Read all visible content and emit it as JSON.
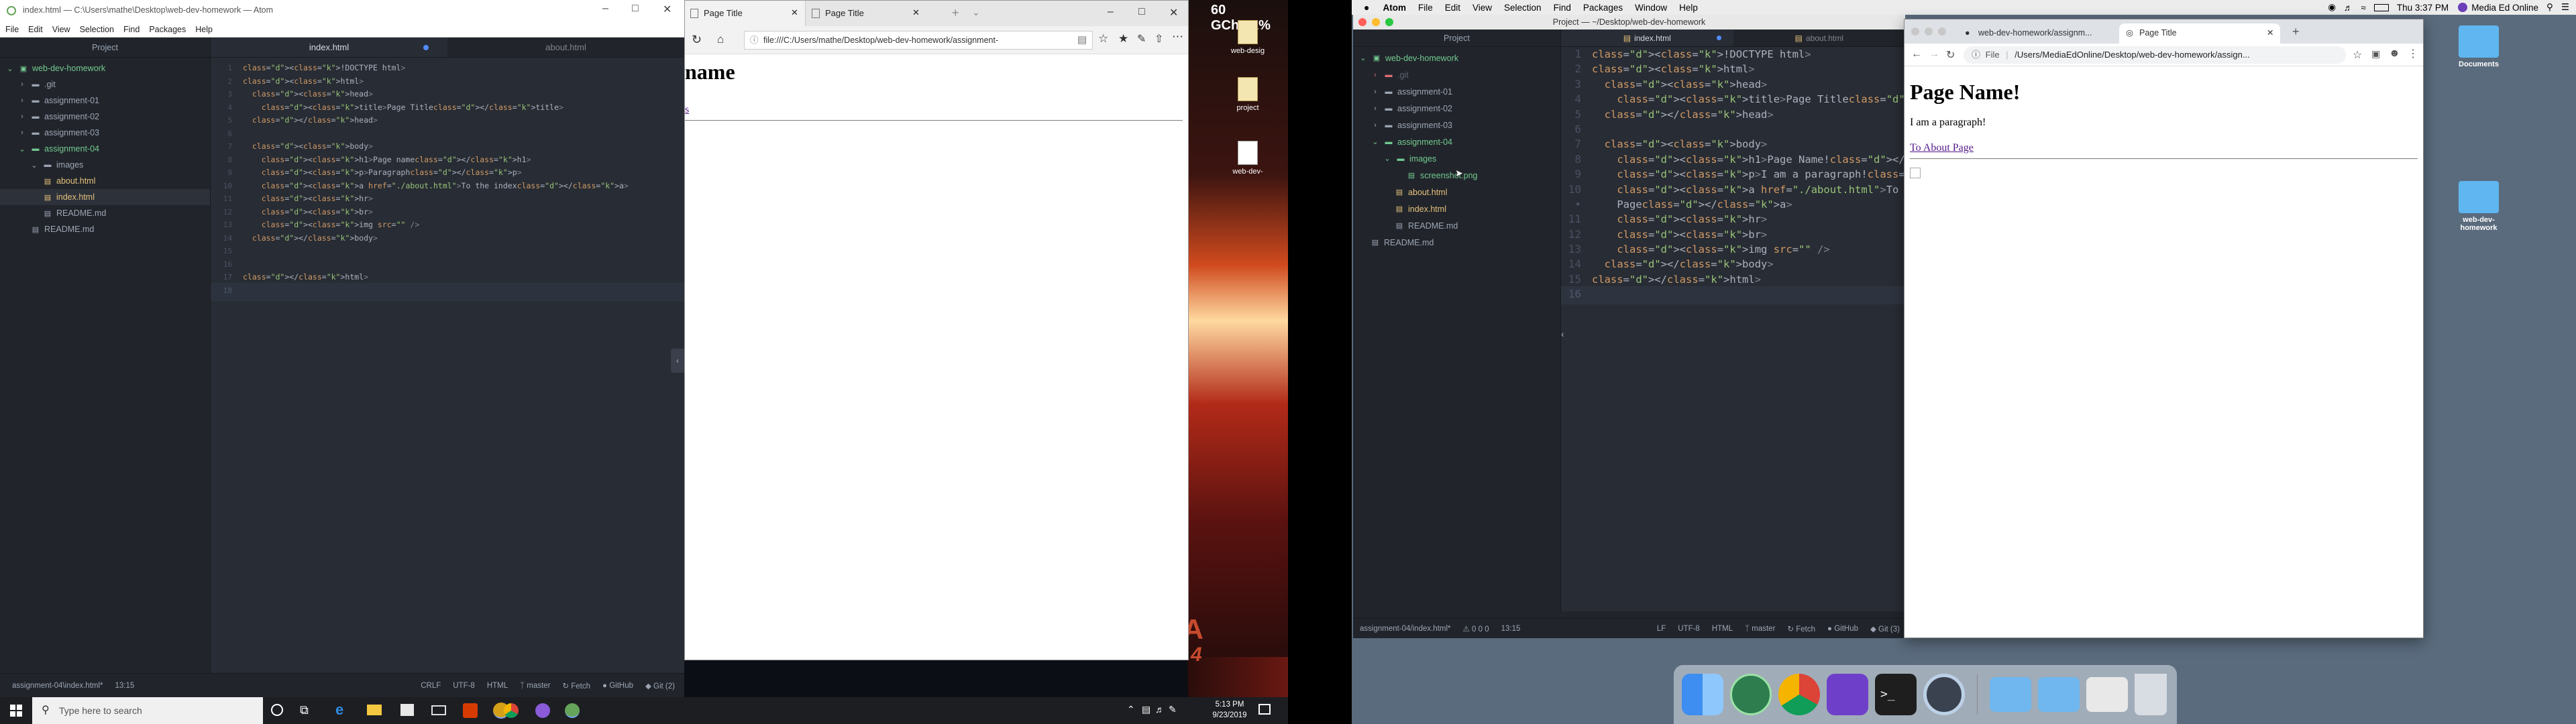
{
  "left": {
    "atom": {
      "window_title": "index.html — C:\\Users\\mathe\\Desktop\\web-dev-homework — Atom",
      "menu": [
        "File",
        "Edit",
        "View",
        "Selection",
        "Find",
        "Packages",
        "Help"
      ],
      "project_header": "Project",
      "tree": [
        {
          "label": "web-dev-homework",
          "type": "root",
          "depth": 0
        },
        {
          "label": ".git",
          "type": "folder",
          "depth": 1
        },
        {
          "label": "assignment-01",
          "type": "folder",
          "depth": 1
        },
        {
          "label": "assignment-02",
          "type": "folder",
          "depth": 1
        },
        {
          "label": "assignment-03",
          "type": "folder",
          "depth": 1
        },
        {
          "label": "assignment-04",
          "type": "folder-open",
          "depth": 1
        },
        {
          "label": "images",
          "type": "folder-open",
          "depth": 2
        },
        {
          "label": "about.html",
          "type": "file",
          "depth": 2
        },
        {
          "label": "index.html",
          "type": "file-active",
          "depth": 2
        },
        {
          "label": "README.md",
          "type": "file",
          "depth": 2
        },
        {
          "label": "README.md",
          "type": "file",
          "depth": 1
        }
      ],
      "tabs": [
        {
          "label": "index.html",
          "active": true,
          "modified": true
        },
        {
          "label": "about.html",
          "active": false,
          "modified": false
        }
      ],
      "line_numbers": [
        "1",
        "2",
        "3",
        "4",
        "5",
        "6",
        "7",
        "8",
        "9",
        "10",
        "11",
        "12",
        "13",
        "14",
        "15",
        "16",
        "17",
        "18"
      ],
      "code": [
        "<!DOCTYPE html>",
        "<html>",
        "  <head>",
        "    <title>Page Title</title>",
        "  </head>",
        "",
        "  <body>",
        "    <h1>Page name</h1>",
        "    <p>Paragraph</p>",
        "    <a href=\"./about.html\">To the index</a>",
        "    <hr>",
        "    <br>",
        "    <img src=\"\" />",
        "  </body>",
        "",
        "",
        "</html>",
        ""
      ],
      "status": {
        "path": "assignment-04\\index.html*",
        "cursor": "13:15",
        "items": [
          "CRLF",
          "UTF-8",
          "HTML",
          "master",
          "Fetch",
          "GitHub",
          "Git (2)"
        ]
      }
    },
    "edge": {
      "tabs": [
        "Page Title",
        "Page Title"
      ],
      "address": "file:///C:/Users/mathe/Desktop/web-dev-homework/assignment-",
      "page_heading": "name",
      "page_link": "s"
    },
    "desktop_icons": [
      "web-desig",
      "project",
      "web-dev-"
    ],
    "battery": "60 GCh:61%",
    "taskbar": {
      "search_placeholder": "Type here to search",
      "time": "5:13 PM",
      "date": "9/23/2019"
    },
    "wallpaper_text": [
      "ZA",
      "4"
    ]
  },
  "right": {
    "menubar": {
      "items": [
        "Atom",
        "File",
        "Edit",
        "View",
        "Selection",
        "Find",
        "Packages",
        "Window",
        "Help"
      ],
      "clock": "Thu 3:37 PM",
      "user": "Media Ed Online"
    },
    "atom": {
      "window_title": "Project — ~/Desktop/web-dev-homework",
      "project_header": "Project",
      "tree": [
        {
          "label": "web-dev-homework",
          "type": "root",
          "depth": 0
        },
        {
          "label": ".git",
          "type": "folder",
          "depth": 1
        },
        {
          "label": "assignment-01",
          "type": "folder",
          "depth": 1
        },
        {
          "label": "assignment-02",
          "type": "folder",
          "depth": 1
        },
        {
          "label": "assignment-03",
          "type": "folder",
          "depth": 1
        },
        {
          "label": "assignment-04",
          "type": "folder-open",
          "depth": 1
        },
        {
          "label": "images",
          "type": "folder-open",
          "depth": 2
        },
        {
          "label": "screenshot.png",
          "type": "image",
          "depth": 3
        },
        {
          "label": "about.html",
          "type": "file",
          "depth": 2
        },
        {
          "label": "index.html",
          "type": "file",
          "depth": 2
        },
        {
          "label": "README.md",
          "type": "file",
          "depth": 2
        },
        {
          "label": "README.md",
          "type": "file",
          "depth": 1
        }
      ],
      "tabs": [
        {
          "label": "index.html",
          "active": true,
          "modified": true
        },
        {
          "label": "about.html",
          "active": false,
          "modified": false
        }
      ],
      "line_numbers": [
        "1",
        "2",
        "3",
        "4",
        "5",
        "6",
        "7",
        "8",
        "9",
        "10",
        "•",
        "11",
        "12",
        "13",
        "14",
        "15",
        "16"
      ],
      "code": [
        "<!DOCTYPE html>",
        "<html>",
        "  <head>",
        "    <title>Page Title</title>",
        "  </head>",
        "",
        "  <body>",
        "    <h1>Page Name!</h1>",
        "    <p>I am a paragraph!</p>",
        "    <a href=\"./about.html\">To About",
        "    Page</a>",
        "    <hr>",
        "    <br>",
        "    <img src=\"\" />",
        "  </body>",
        "</html>",
        ""
      ],
      "status": {
        "path": "assignment-04/index.html*",
        "cursor": "13:15",
        "items": [
          "LF",
          "UTF-8",
          "HTML",
          "master",
          "Fetch",
          "GitHub",
          "Git (3)"
        ],
        "diag": "0 0 0"
      }
    },
    "chrome": {
      "tabs": [
        "web-dev-homework/assignm...",
        "Page Title"
      ],
      "address_prefix": "File",
      "address": "/Users/MediaEdOnline/Desktop/web-dev-homework/assign...",
      "page_heading": "Page Name!",
      "page_paragraph": "I am a paragraph!",
      "page_link": "To About Page"
    },
    "desktop_icons": [
      "Documents",
      "web-dev-homework"
    ]
  }
}
